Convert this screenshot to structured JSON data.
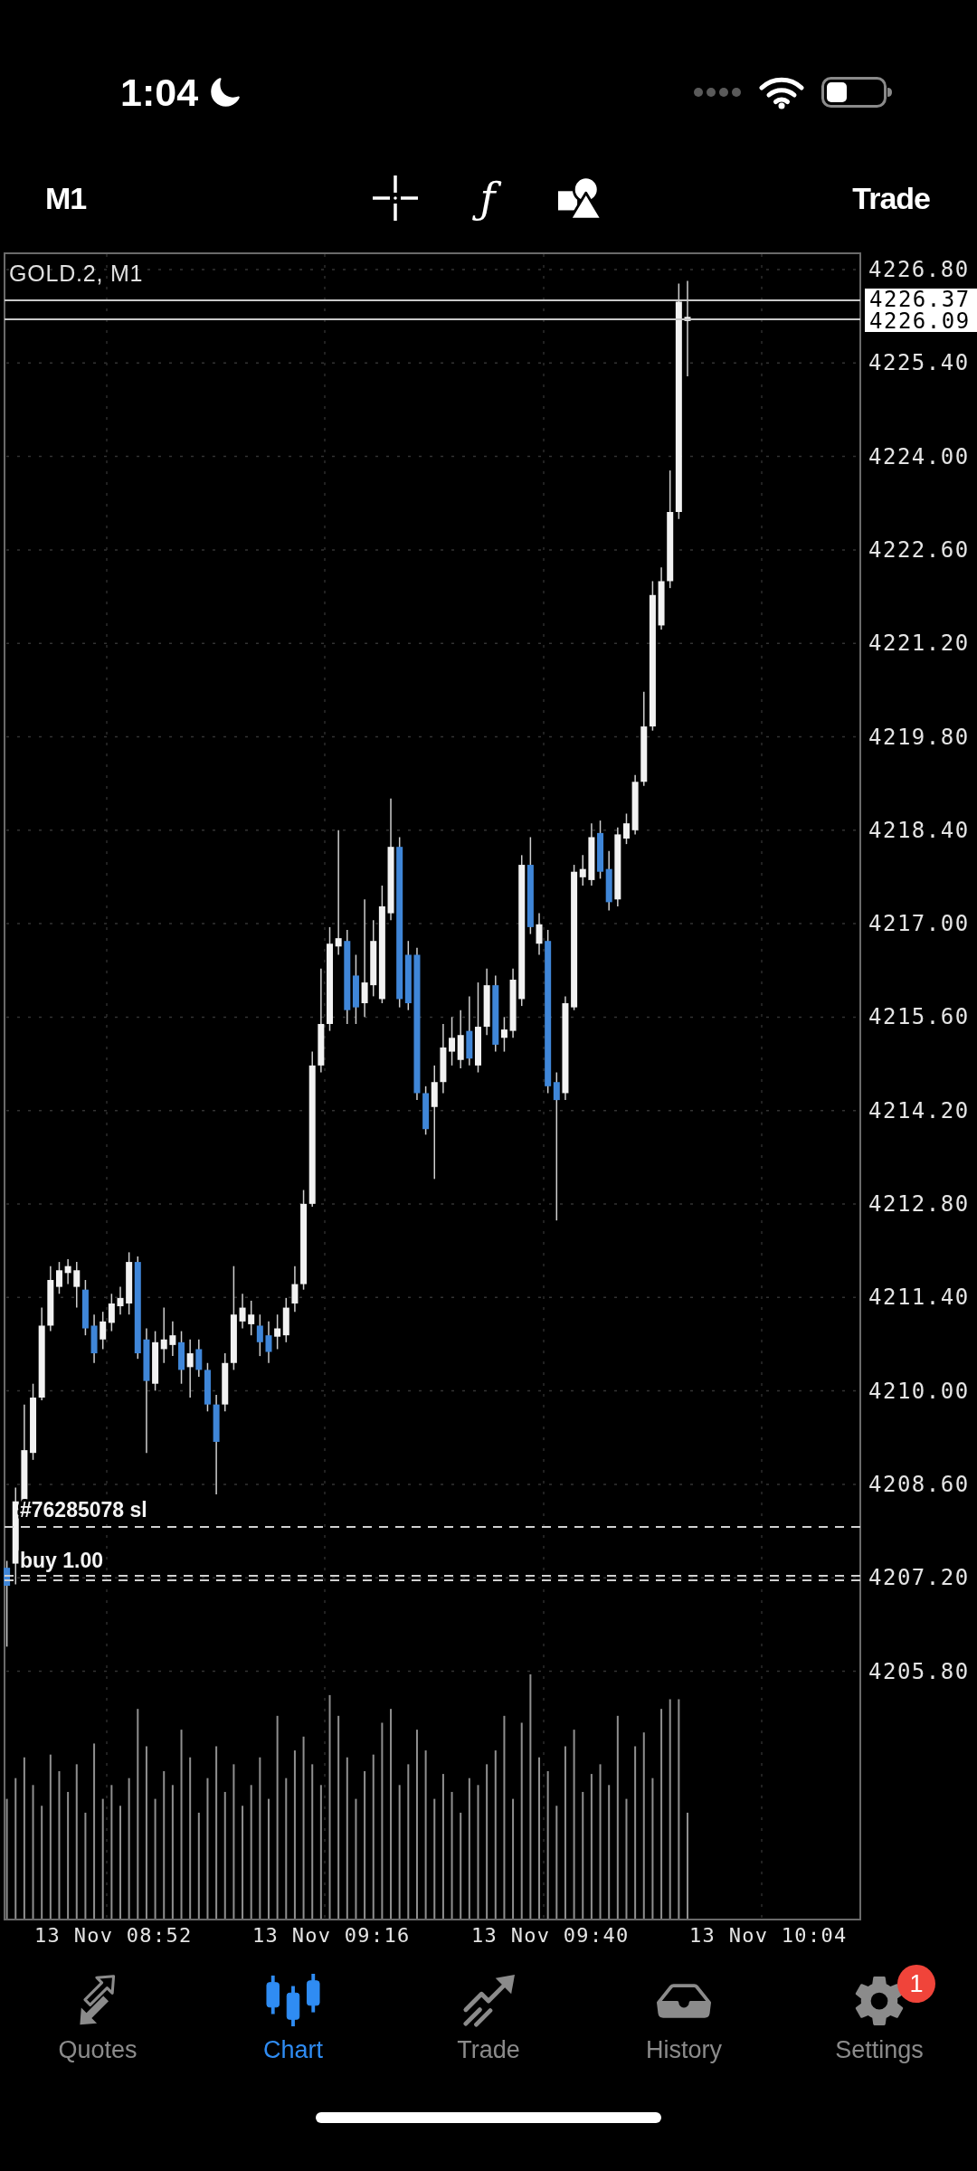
{
  "status_bar": {
    "time": "1:04"
  },
  "toolbar": {
    "timeframe": "M1",
    "function_button": "ƒ",
    "trade": "Trade"
  },
  "chart": {
    "title": "GOLD.2, M1",
    "price_axis": [
      "4226.80",
      "4225.40",
      "4224.00",
      "4222.60",
      "4221.20",
      "4219.80",
      "4218.40",
      "4217.00",
      "4215.60",
      "4214.20",
      "4212.80",
      "4211.40",
      "4210.00",
      "4208.60",
      "4207.20",
      "4205.80"
    ],
    "price_tags": [
      "4226.37",
      "4226.09"
    ],
    "orders": [
      {
        "label": "#76285078 sl",
        "kind": "stop_loss"
      },
      {
        "label": "buy 1.00",
        "kind": "position"
      }
    ],
    "time_axis": [
      "13 Nov 08:52",
      "13 Nov 09:16",
      "13 Nov 09:40",
      "13 Nov 10:04"
    ]
  },
  "tabs": [
    {
      "label": "Quotes",
      "selected": false
    },
    {
      "label": "Chart",
      "selected": true
    },
    {
      "label": "Trade",
      "selected": false
    },
    {
      "label": "History",
      "selected": false
    },
    {
      "label": "Settings",
      "selected": false,
      "badge": "1"
    }
  ]
}
